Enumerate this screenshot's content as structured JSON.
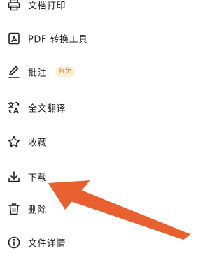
{
  "menu": {
    "items": [
      {
        "label": "文档打印",
        "icon": "printer-icon"
      },
      {
        "label": "PDF 转换工具",
        "icon": "pdf-icon"
      },
      {
        "label": "批注",
        "icon": "pen-icon",
        "badge": "限免"
      },
      {
        "label": "全文翻译",
        "icon": "translate-icon"
      },
      {
        "label": "收藏",
        "icon": "star-icon"
      },
      {
        "label": "下载",
        "icon": "download-icon"
      },
      {
        "label": "删除",
        "icon": "trash-icon"
      },
      {
        "label": "文件详情",
        "icon": "info-icon"
      }
    ]
  },
  "colors": {
    "badge_bg": "#fcefd3",
    "badge_text": "#c4811a",
    "annotation_arrow": "#e8602f"
  }
}
